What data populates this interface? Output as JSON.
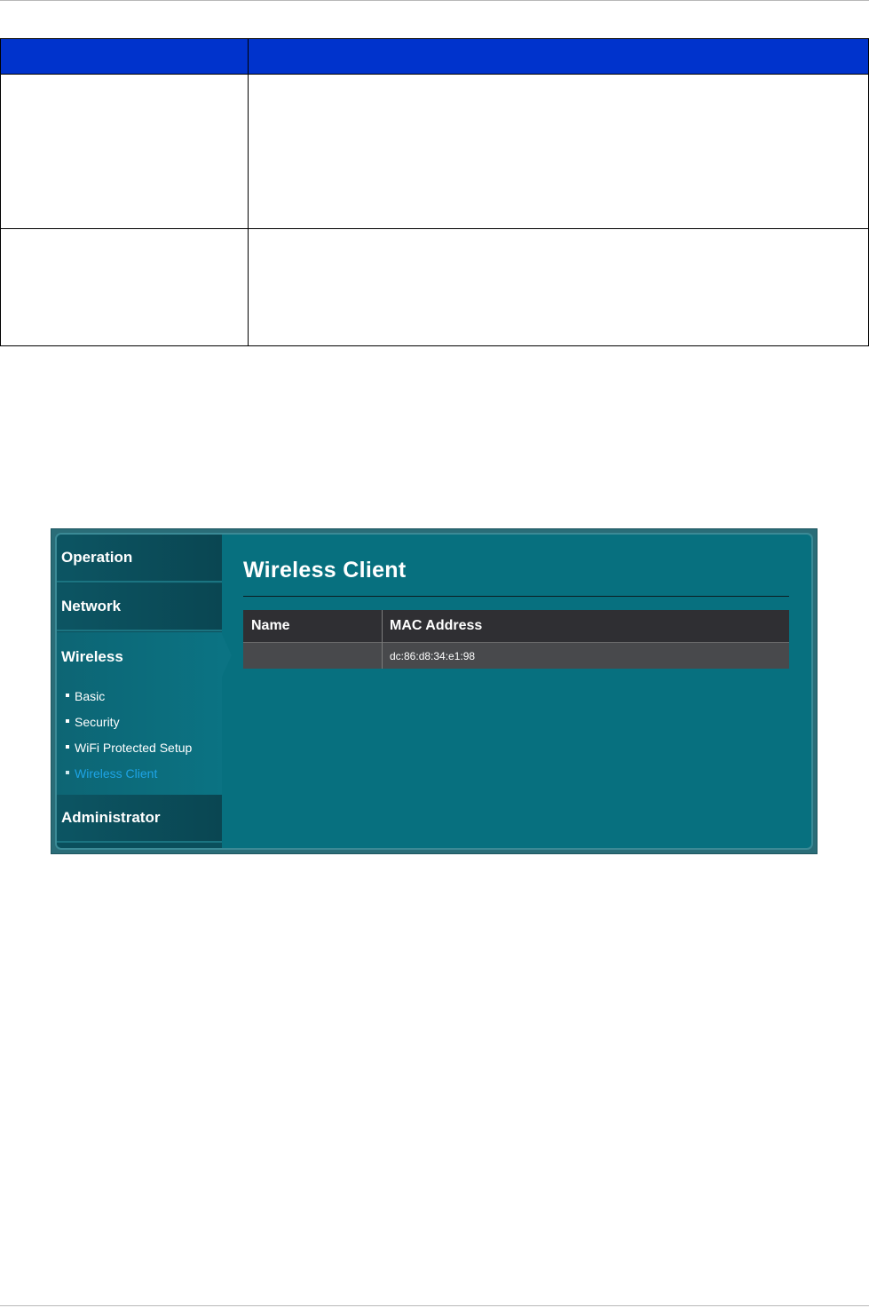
{
  "wireless_client_screen": {
    "sidebar": {
      "operation": "Operation",
      "network": "Network",
      "wireless": "Wireless",
      "wireless_items": [
        "Basic",
        "Security",
        "WiFi Protected Setup",
        "Wireless Client"
      ],
      "active_item": "Wireless Client",
      "administrator": "Administrator"
    },
    "page_title": "Wireless Client",
    "table": {
      "headers": [
        "Name",
        "MAC Address"
      ],
      "rows": [
        {
          "name": "",
          "mac": "dc:86:d8:34:e1:98"
        }
      ]
    },
    "colors": {
      "doc_table_header": "#0033cc",
      "panel_background": "#07707f",
      "active_link": "#1ea4e6"
    }
  }
}
